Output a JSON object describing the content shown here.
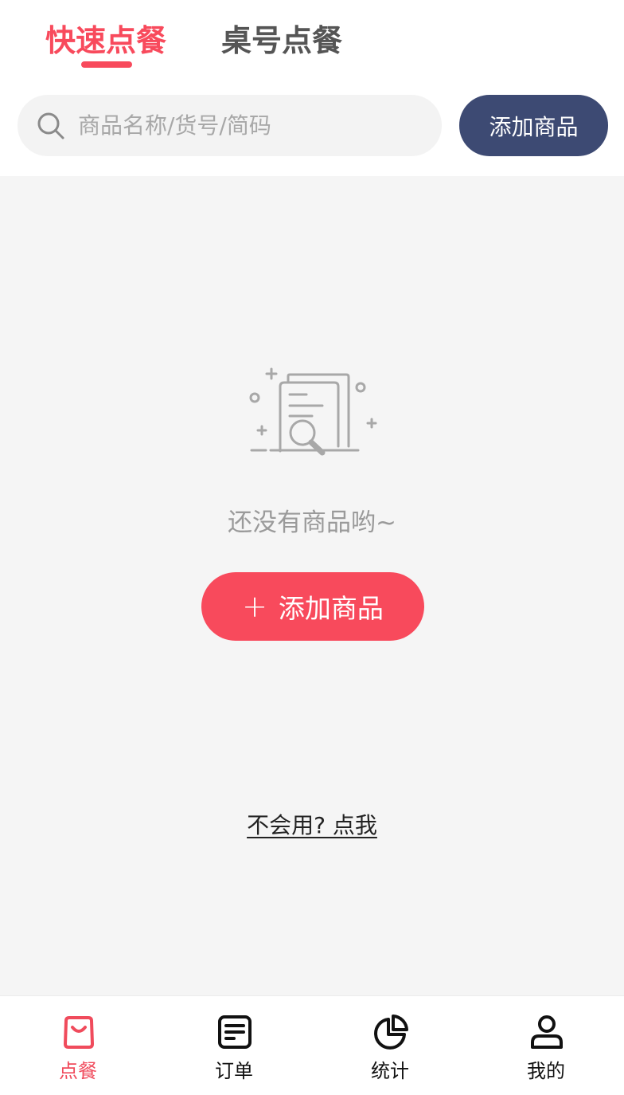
{
  "colors": {
    "accent": "#f84a5c",
    "tab_inactive": "#555555",
    "dark_button": "#3d4a73",
    "background": "#f5f5f5"
  },
  "tabs": [
    {
      "label": "快速点餐",
      "active": true
    },
    {
      "label": "桌号点餐",
      "active": false
    }
  ],
  "search": {
    "placeholder": "商品名称/货号/简码",
    "value": "",
    "icon": "search-icon"
  },
  "top_add_button": {
    "label": "添加商品"
  },
  "empty_state": {
    "icon": "empty-documents-search-icon",
    "message": "还没有商品哟~",
    "button_icon": "+",
    "button_label": "添加商品"
  },
  "help": {
    "label": "不会用? 点我"
  },
  "bottom_nav": [
    {
      "label": "点餐",
      "icon": "shopping-bag-icon",
      "active": true
    },
    {
      "label": "订单",
      "icon": "order-list-icon",
      "active": false
    },
    {
      "label": "统计",
      "icon": "pie-chart-icon",
      "active": false
    },
    {
      "label": "我的",
      "icon": "user-icon",
      "active": false
    }
  ]
}
